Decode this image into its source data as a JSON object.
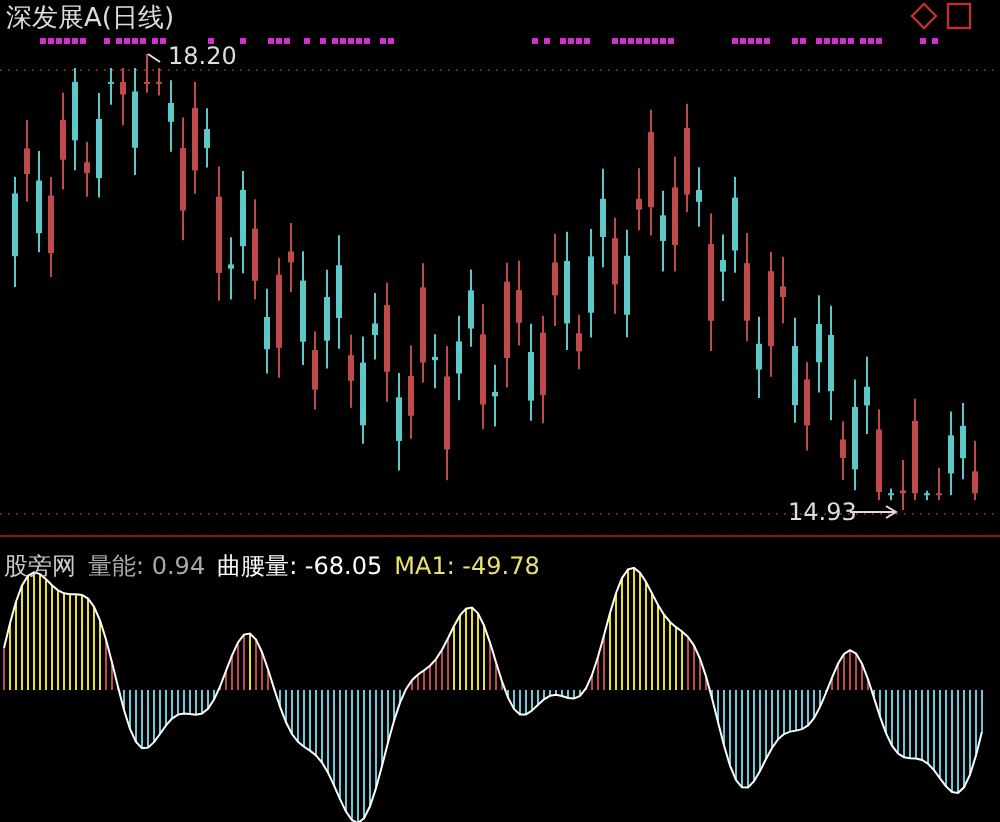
{
  "price_chart": {
    "title": "深发展A(日线)",
    "high_label": "18.20",
    "low_label": "14.93"
  },
  "indicator": {
    "name": "股旁网",
    "readings": [
      {
        "kind": "volume",
        "text": "量能: 0.94"
      },
      {
        "kind": "curve",
        "text": "曲腰量: -68.05"
      },
      {
        "kind": "ma",
        "text": "MA1: -49.78"
      }
    ]
  }
}
